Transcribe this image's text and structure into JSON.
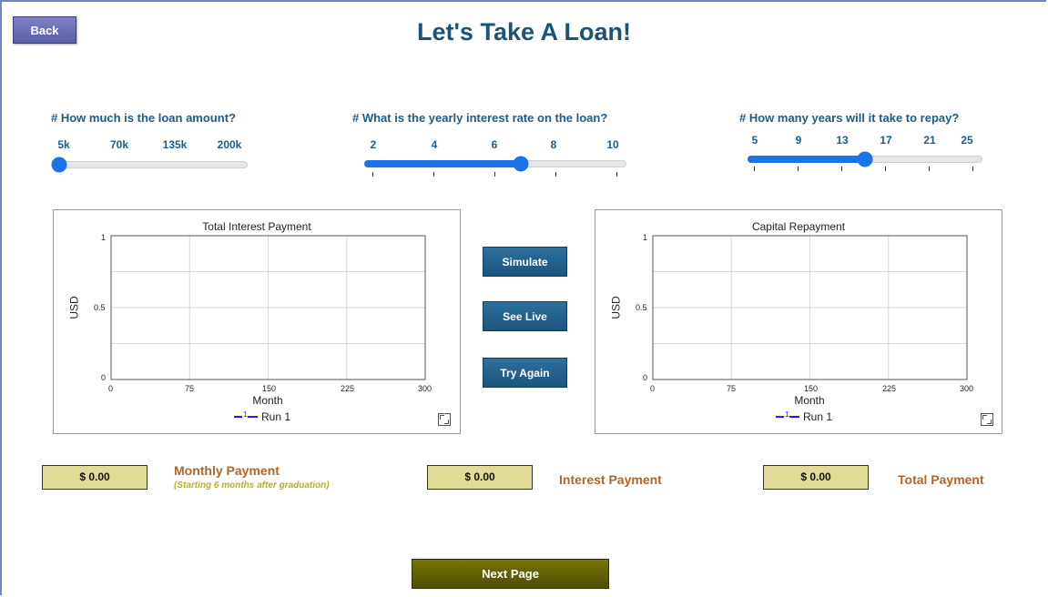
{
  "header": {
    "back_label": "Back",
    "title": "Let's Take A Loan!"
  },
  "sliders": [
    {
      "question": "# How much is the loan amount?",
      "tick_labels": [
        "5k",
        "70k",
        "135k",
        "200k"
      ],
      "value_fraction": 0.0
    },
    {
      "question": "# What is the yearly interest rate on the loan?",
      "tick_labels": [
        "2",
        "4",
        "6",
        "8",
        "10"
      ],
      "value_fraction": 0.6
    },
    {
      "question": "# How many years will it take to repay?",
      "tick_labels": [
        "5",
        "9",
        "13",
        "17",
        "21",
        "25"
      ],
      "value_fraction": 0.5
    }
  ],
  "buttons": {
    "simulate": "Simulate",
    "see_live": "See Live",
    "try_again": "Try Again",
    "next_page": "Next Page"
  },
  "chart_data": [
    {
      "type": "line",
      "title": "Total Interest Payment",
      "xlabel": "Month",
      "ylabel": "USD",
      "x_ticks": [
        "0",
        "75",
        "150",
        "225",
        "300"
      ],
      "y_ticks": [
        "0",
        "0.5",
        "1"
      ],
      "xlim": [
        0,
        300
      ],
      "ylim": [
        0,
        1
      ],
      "grid": true,
      "legend": "bottom-center",
      "series": [
        {
          "name": "Run 1",
          "values": [],
          "color": "#1a1aff"
        }
      ]
    },
    {
      "type": "line",
      "title": "Capital Repayment",
      "xlabel": "Month",
      "ylabel": "USD",
      "x_ticks": [
        "0",
        "75",
        "150",
        "225",
        "300"
      ],
      "y_ticks": [
        "0",
        "0.5",
        "1"
      ],
      "xlim": [
        0,
        300
      ],
      "ylim": [
        0,
        1
      ],
      "grid": true,
      "legend": "bottom-center",
      "series": [
        {
          "name": "Run 1",
          "values": [],
          "color": "#1a1aff"
        }
      ]
    }
  ],
  "legend_marker": "1",
  "outputs": {
    "monthly_value": "$ 0.00",
    "monthly_label": "Monthly Payment",
    "monthly_sub": "(Starting 6 months after graduation)",
    "interest_value": "$ 0.00",
    "interest_label": "Interest Payment",
    "total_value": "$ 0.00",
    "total_label": "Total Payment"
  },
  "colors": {
    "title": "#1b5276",
    "slider_accent": "#1a73e8",
    "action_button": "#1a557f",
    "output_box": "#e0dc96",
    "output_label": "#b0652a",
    "next_button": "#4f4e00"
  }
}
